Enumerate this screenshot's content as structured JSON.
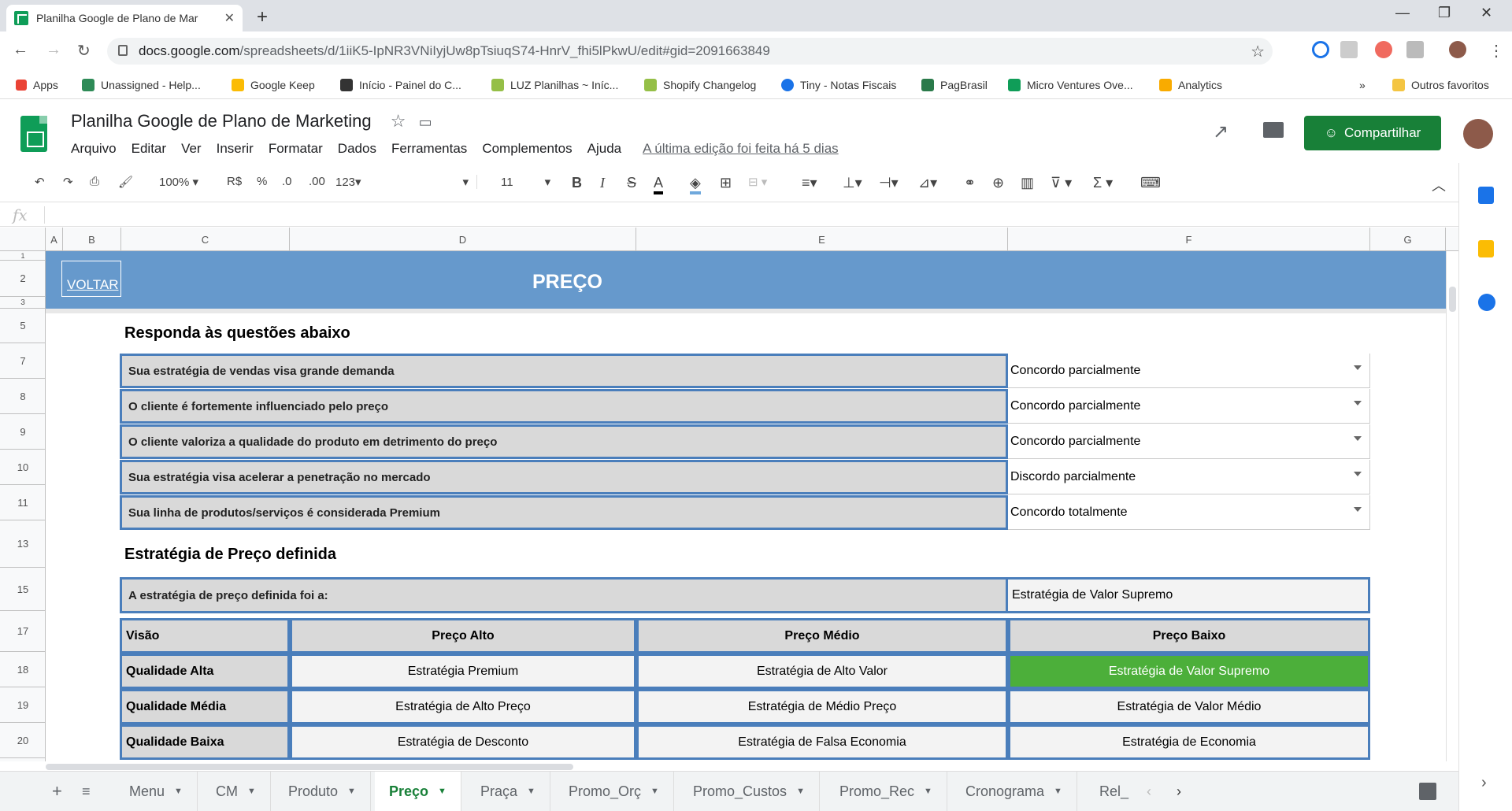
{
  "browser": {
    "tab_title": "Planilha Google de Plano de Mar",
    "url_host": "docs.google.com",
    "url_path": "/spreadsheets/d/1iiK5-IpNR3VNiIyjUw8pTsiuqS74-HnrV_fhi5lPkwU/edit#gid=2091663849"
  },
  "bookmarks": [
    "Apps",
    "Unassigned - Help...",
    "Google Keep",
    "Início - Painel do C...",
    "LUZ Planilhas ~ Iníc...",
    "Shopify Changelog",
    "Tiny - Notas Fiscais",
    "PagBrasil",
    "Micro Ventures Ove...",
    "Analytics"
  ],
  "bookmarks_other": "Outros favoritos",
  "doc": {
    "title": "Planilha Google de Plano de Marketing",
    "menus": [
      "Arquivo",
      "Editar",
      "Ver",
      "Inserir",
      "Formatar",
      "Dados",
      "Ferramentas",
      "Complementos",
      "Ajuda"
    ],
    "last_edit": "A última edição foi feita há 5 dias",
    "share_label": "Compartilhar"
  },
  "toolbar": {
    "zoom": "100%",
    "currency": "R$",
    "percent": "%",
    "dec_less": ".0",
    "dec_more": ".00",
    "format": "123",
    "font_size": "11"
  },
  "columns": [
    "A",
    "B",
    "C",
    "D",
    "E",
    "F",
    "G"
  ],
  "rows": [
    "1",
    "2",
    "3",
    "5",
    "7",
    "8",
    "9",
    "10",
    "11",
    "13",
    "15",
    "17",
    "18",
    "19",
    "20"
  ],
  "banner": {
    "back_link": "VOLTAR",
    "title": "PREÇO"
  },
  "section1_title": "Responda às questões abaixo",
  "questions": [
    {
      "q": "Sua estratégia de vendas visa grande demanda",
      "a": "Concordo parcialmente"
    },
    {
      "q": "O cliente é fortemente influenciado pelo preço",
      "a": "Concordo parcialmente"
    },
    {
      "q": "O cliente valoriza a qualidade do produto em detrimento do preço",
      "a": "Concordo parcialmente"
    },
    {
      "q": "Sua estratégia visa acelerar a penetração no mercado",
      "a": "Discordo parcialmente"
    },
    {
      "q": "Sua linha de produtos/serviços é considerada Premium",
      "a": "Concordo totalmente"
    }
  ],
  "section2_title": "Estratégia de Preço definida",
  "defined": {
    "label": "A estratégia de preço definida foi a:",
    "value": "Estratégia de Valor Supremo"
  },
  "matrix": {
    "corner": "Visão",
    "headers": [
      "Preço Alto",
      "Preço Médio",
      "Preço Baixo"
    ],
    "rows": [
      {
        "label": "Qualidade Alta",
        "cells": [
          "Estratégia Premium",
          "Estratégia de Alto Valor",
          "Estratégia de Valor Supremo"
        ]
      },
      {
        "label": "Qualidade Média",
        "cells": [
          "Estratégia de Alto Preço",
          "Estratégia de Médio Preço",
          "Estratégia de Valor Médio"
        ]
      },
      {
        "label": "Qualidade Baixa",
        "cells": [
          "Estratégia de Desconto",
          "Estratégia de Falsa Economia",
          "Estratégia de Economia"
        ]
      }
    ],
    "highlight_color": "#4caf3a"
  },
  "sheet_tabs": [
    "Menu",
    "CM",
    "Produto",
    "Preço",
    "Praça",
    "Promo_Orç",
    "Promo_Custos",
    "Promo_Rec",
    "Cronograma",
    "Rel_"
  ],
  "active_sheet": "Preço",
  "colors": {
    "brand_green": "#188038",
    "banner_blue": "#6699cc",
    "border_blue": "#4a7ebb"
  }
}
